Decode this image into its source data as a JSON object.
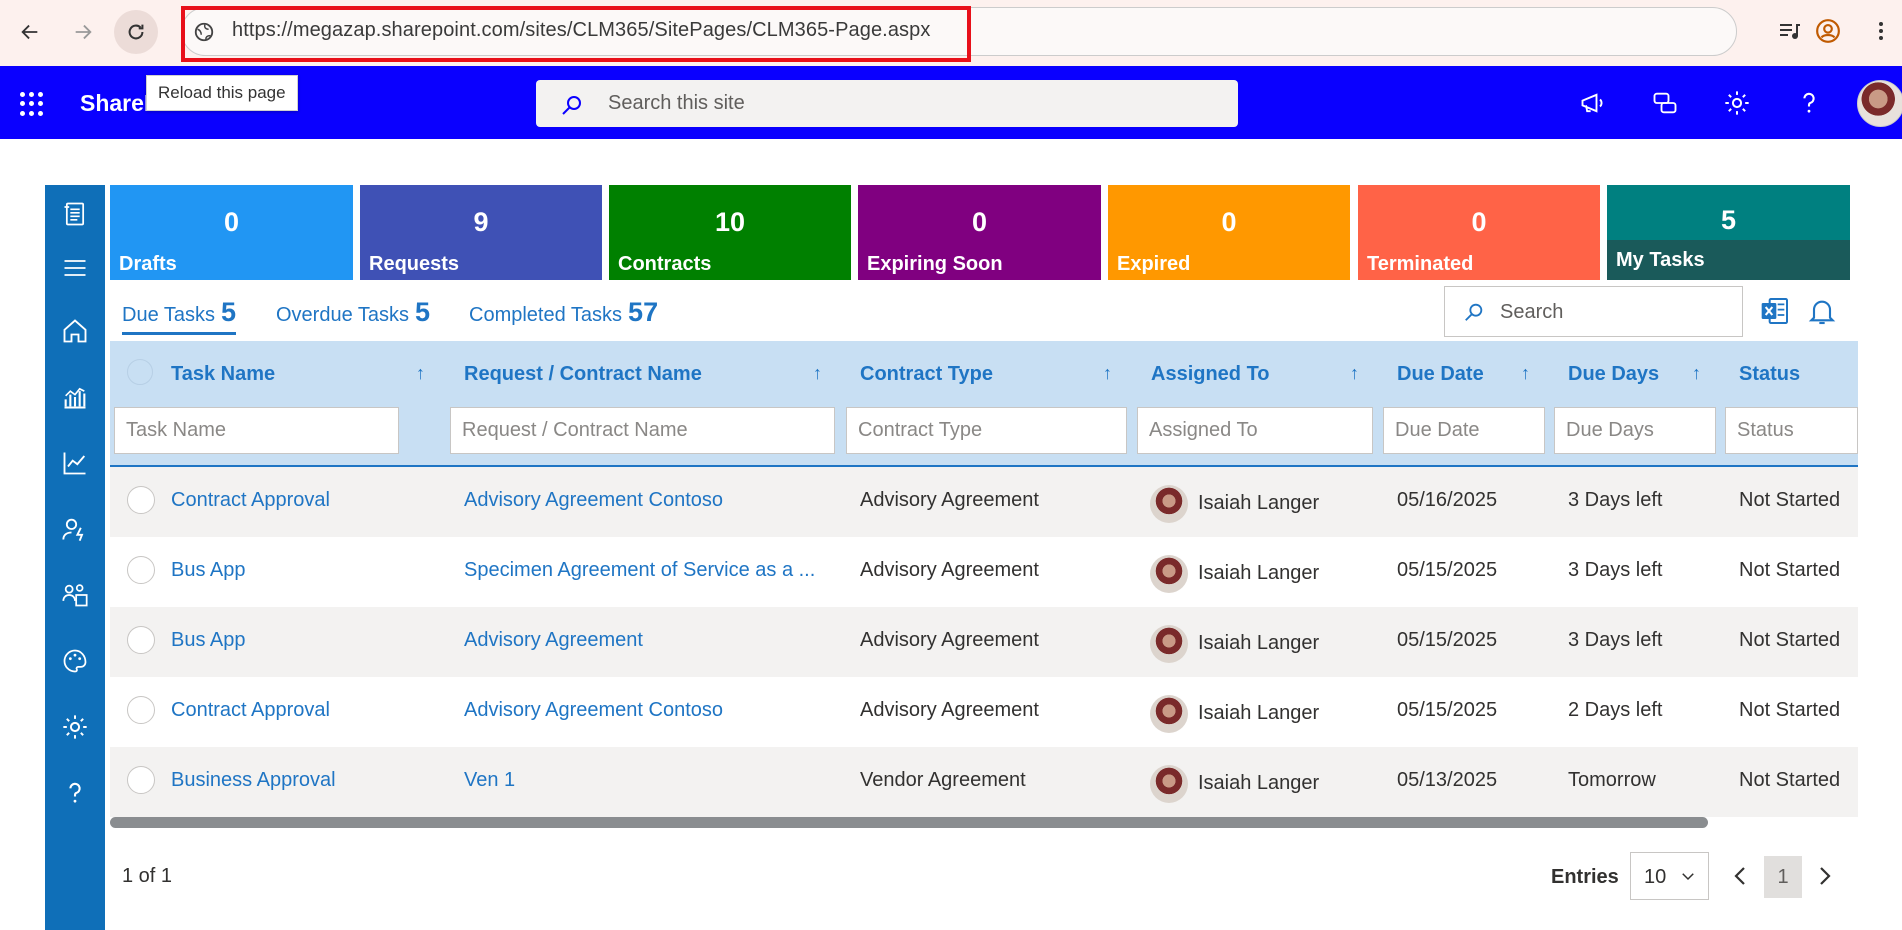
{
  "browser": {
    "url": "https://megazap.sharepoint.com/sites/CLM365/SitePages/CLM365-Page.aspx",
    "tooltip": "Reload this page"
  },
  "suite": {
    "title": "SharePoint",
    "search_placeholder": "Search this site",
    "accent": "#0a00ff"
  },
  "tiles": [
    {
      "value": "0",
      "label": "Drafts",
      "color": "#2196f3"
    },
    {
      "value": "9",
      "label": "Requests",
      "color": "#3f51b5"
    },
    {
      "value": "10",
      "label": "Contracts",
      "color": "#008000"
    },
    {
      "value": "0",
      "label": "Expiring Soon",
      "color": "#800080"
    },
    {
      "value": "0",
      "label": "Expired",
      "color": "#ff9800"
    },
    {
      "value": "0",
      "label": "Terminated",
      "color": "#ff6347"
    },
    {
      "value": "5",
      "label": "My Tasks",
      "color": "#008080"
    }
  ],
  "tabs": [
    {
      "label": "Due Tasks",
      "count": "5"
    },
    {
      "label": "Overdue Tasks",
      "count": "5"
    },
    {
      "label": "Completed Tasks",
      "count": "57"
    }
  ],
  "grid_search_placeholder": "Search",
  "columns": [
    {
      "label": "Task Name",
      "filter": "Task Name"
    },
    {
      "label": "Request / Contract Name",
      "filter": "Request / Contract Name"
    },
    {
      "label": "Contract Type",
      "filter": "Contract Type"
    },
    {
      "label": "Assigned To",
      "filter": "Assigned To"
    },
    {
      "label": "Due Date",
      "filter": "Due Date"
    },
    {
      "label": "Due Days",
      "filter": "Due Days"
    },
    {
      "label": "Status",
      "filter": "Status"
    }
  ],
  "rows": [
    {
      "task": "Contract Approval",
      "request": "Advisory Agreement Contoso",
      "type": "Advisory Agreement",
      "assignee": "Isaiah Langer",
      "due_date": "05/16/2025",
      "due_days": "3 Days left",
      "status": "Not Started"
    },
    {
      "task": "Bus App",
      "request": "Specimen Agreement of Service as a ...",
      "type": "Advisory Agreement",
      "assignee": "Isaiah Langer",
      "due_date": "05/15/2025",
      "due_days": "3 Days left",
      "status": "Not Started"
    },
    {
      "task": "Bus App",
      "request": "Advisory Agreement",
      "type": "Advisory Agreement",
      "assignee": "Isaiah Langer",
      "due_date": "05/15/2025",
      "due_days": "3 Days left",
      "status": "Not Started"
    },
    {
      "task": "Contract Approval",
      "request": "Advisory Agreement Contoso",
      "type": "Advisory Agreement",
      "assignee": "Isaiah Langer",
      "due_date": "05/15/2025",
      "due_days": "2 Days left",
      "status": "Not Started"
    },
    {
      "task": "Business Approval",
      "request": "Ven 1",
      "type": "Vendor Agreement",
      "assignee": "Isaiah Langer",
      "due_date": "05/13/2025",
      "due_days": "Tomorrow",
      "status": "Not Started"
    }
  ],
  "footer": {
    "page_info": "1 of 1",
    "entries_label": "Entries",
    "entries_value": "10",
    "current_page": "1"
  },
  "icons": [
    "back-icon",
    "forward-icon",
    "reload-icon",
    "site-info-icon",
    "media-icon",
    "profile-icon",
    "more-icon",
    "waffle-icon",
    "search-icon",
    "megaphone-icon",
    "feedback-icon",
    "settings-icon",
    "help-icon",
    "excel-icon",
    "bell-icon"
  ]
}
